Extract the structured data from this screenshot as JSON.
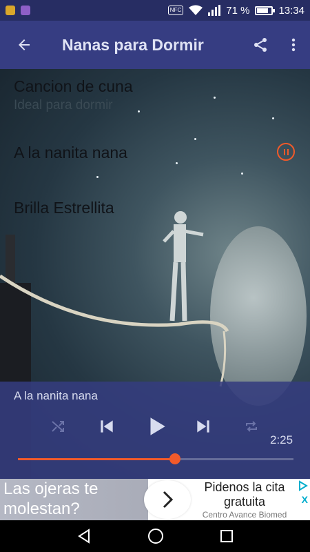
{
  "status_bar": {
    "nfc": "NFC",
    "battery_percent": "71 %",
    "battery_level": 0.71,
    "time": "13:34"
  },
  "app_bar": {
    "title": "Nanas para Dormir",
    "back_icon": "arrow-back-icon",
    "share_icon": "share-icon",
    "menu_icon": "more-vert-icon"
  },
  "songs": [
    {
      "title": "Cancion de cuna",
      "subtitle": "Ideal para dormir"
    },
    {
      "title": "A la nanita nana",
      "playing": true
    },
    {
      "title": "Brilla Estrellita"
    }
  ],
  "player": {
    "now_playing": "A la nanita nana",
    "time": "2:25",
    "progress": 0.57,
    "accent": "#f25a2a"
  },
  "ad": {
    "left_text": "Las ojeras te molestan?",
    "headline": "Pidenos la cita gratuita",
    "sponsor": "Centro Avance Biomed",
    "close": "X"
  },
  "colors": {
    "app_bar": "#363d82",
    "status_bar": "#272d63",
    "player_panel": "#343c7e",
    "accent": "#f25a2a"
  }
}
